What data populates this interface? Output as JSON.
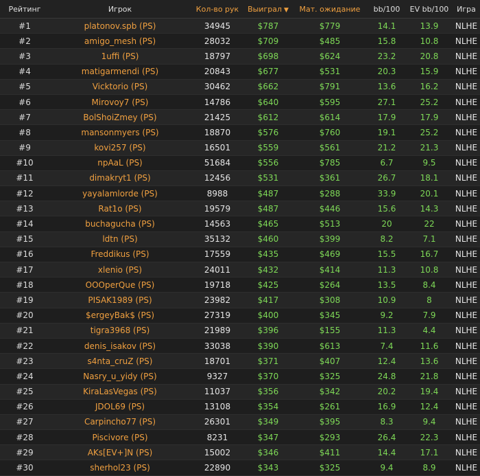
{
  "colors": {
    "accent": "#f0a040",
    "positive": "#7ed957",
    "background": "#1c1c1c"
  },
  "header": {
    "rank": "Рейтинг",
    "player": "Игрок",
    "hands": "Кол-во рук",
    "won": "Выиграл",
    "ev": "Мат. ожидание",
    "bb100": "bb/100",
    "evbb100": "EV bb/100",
    "game": "Игра",
    "sort_icon": "caret-down-icon"
  },
  "rows": [
    {
      "rank": "#1",
      "player": "platonov.spb (PS)",
      "hands": "34945",
      "won": "$787",
      "ev": "$779",
      "bb": "14.1",
      "evbb": "13.9",
      "game": "NLHE"
    },
    {
      "rank": "#2",
      "player": "amigo_mesh (PS)",
      "hands": "28032",
      "won": "$709",
      "ev": "$485",
      "bb": "15.8",
      "evbb": "10.8",
      "game": "NLHE"
    },
    {
      "rank": "#3",
      "player": "1uffi (PS)",
      "hands": "18797",
      "won": "$698",
      "ev": "$624",
      "bb": "23.2",
      "evbb": "20.8",
      "game": "NLHE"
    },
    {
      "rank": "#4",
      "player": "matigarmendi (PS)",
      "hands": "20843",
      "won": "$677",
      "ev": "$531",
      "bb": "20.3",
      "evbb": "15.9",
      "game": "NLHE"
    },
    {
      "rank": "#5",
      "player": "Vicktorio (PS)",
      "hands": "30462",
      "won": "$662",
      "ev": "$791",
      "bb": "13.6",
      "evbb": "16.2",
      "game": "NLHE"
    },
    {
      "rank": "#6",
      "player": "Mirovoy7 (PS)",
      "hands": "14786",
      "won": "$640",
      "ev": "$595",
      "bb": "27.1",
      "evbb": "25.2",
      "game": "NLHE"
    },
    {
      "rank": "#7",
      "player": "BolShoiZmey (PS)",
      "hands": "21425",
      "won": "$612",
      "ev": "$614",
      "bb": "17.9",
      "evbb": "17.9",
      "game": "NLHE"
    },
    {
      "rank": "#8",
      "player": "mansonmyers (PS)",
      "hands": "18870",
      "won": "$576",
      "ev": "$760",
      "bb": "19.1",
      "evbb": "25.2",
      "game": "NLHE"
    },
    {
      "rank": "#9",
      "player": "kovi257 (PS)",
      "hands": "16501",
      "won": "$559",
      "ev": "$561",
      "bb": "21.2",
      "evbb": "21.3",
      "game": "NLHE"
    },
    {
      "rank": "#10",
      "player": "npAaL (PS)",
      "hands": "51684",
      "won": "$556",
      "ev": "$785",
      "bb": "6.7",
      "evbb": "9.5",
      "game": "NLHE"
    },
    {
      "rank": "#11",
      "player": "dimakryt1 (PS)",
      "hands": "12456",
      "won": "$531",
      "ev": "$361",
      "bb": "26.7",
      "evbb": "18.1",
      "game": "NLHE"
    },
    {
      "rank": "#12",
      "player": "yayalamlorde (PS)",
      "hands": "8988",
      "won": "$487",
      "ev": "$288",
      "bb": "33.9",
      "evbb": "20.1",
      "game": "NLHE"
    },
    {
      "rank": "#13",
      "player": "Rat1o (PS)",
      "hands": "19579",
      "won": "$487",
      "ev": "$446",
      "bb": "15.6",
      "evbb": "14.3",
      "game": "NLHE"
    },
    {
      "rank": "#14",
      "player": "buchagucha (PS)",
      "hands": "14563",
      "won": "$465",
      "ev": "$513",
      "bb": "20",
      "evbb": "22",
      "game": "NLHE"
    },
    {
      "rank": "#15",
      "player": "ldtn (PS)",
      "hands": "35132",
      "won": "$460",
      "ev": "$399",
      "bb": "8.2",
      "evbb": "7.1",
      "game": "NLHE"
    },
    {
      "rank": "#16",
      "player": "Freddikus (PS)",
      "hands": "17559",
      "won": "$435",
      "ev": "$469",
      "bb": "15.5",
      "evbb": "16.7",
      "game": "NLHE"
    },
    {
      "rank": "#17",
      "player": "xlenio (PS)",
      "hands": "24011",
      "won": "$432",
      "ev": "$414",
      "bb": "11.3",
      "evbb": "10.8",
      "game": "NLHE"
    },
    {
      "rank": "#18",
      "player": "OOOperQue (PS)",
      "hands": "19718",
      "won": "$425",
      "ev": "$264",
      "bb": "13.5",
      "evbb": "8.4",
      "game": "NLHE"
    },
    {
      "rank": "#19",
      "player": "PISAK1989 (PS)",
      "hands": "23982",
      "won": "$417",
      "ev": "$308",
      "bb": "10.9",
      "evbb": "8",
      "game": "NLHE"
    },
    {
      "rank": "#20",
      "player": "$ergeyBak$ (PS)",
      "hands": "27319",
      "won": "$400",
      "ev": "$345",
      "bb": "9.2",
      "evbb": "7.9",
      "game": "NLHE"
    },
    {
      "rank": "#21",
      "player": "tigra3968 (PS)",
      "hands": "21989",
      "won": "$396",
      "ev": "$155",
      "bb": "11.3",
      "evbb": "4.4",
      "game": "NLHE"
    },
    {
      "rank": "#22",
      "player": "denis_isakov (PS)",
      "hands": "33038",
      "won": "$390",
      "ev": "$613",
      "bb": "7.4",
      "evbb": "11.6",
      "game": "NLHE"
    },
    {
      "rank": "#23",
      "player": "s4nta_cruZ (PS)",
      "hands": "18701",
      "won": "$371",
      "ev": "$407",
      "bb": "12.4",
      "evbb": "13.6",
      "game": "NLHE"
    },
    {
      "rank": "#24",
      "player": "Nasry_u_yidy (PS)",
      "hands": "9327",
      "won": "$370",
      "ev": "$325",
      "bb": "24.8",
      "evbb": "21.8",
      "game": "NLHE"
    },
    {
      "rank": "#25",
      "player": "KiraLasVegas (PS)",
      "hands": "11037",
      "won": "$356",
      "ev": "$342",
      "bb": "20.2",
      "evbb": "19.4",
      "game": "NLHE"
    },
    {
      "rank": "#26",
      "player": "JDOL69 (PS)",
      "hands": "13108",
      "won": "$354",
      "ev": "$261",
      "bb": "16.9",
      "evbb": "12.4",
      "game": "NLHE"
    },
    {
      "rank": "#27",
      "player": "Carpincho77 (PS)",
      "hands": "26301",
      "won": "$349",
      "ev": "$395",
      "bb": "8.3",
      "evbb": "9.4",
      "game": "NLHE"
    },
    {
      "rank": "#28",
      "player": "Piscivore (PS)",
      "hands": "8231",
      "won": "$347",
      "ev": "$293",
      "bb": "26.4",
      "evbb": "22.3",
      "game": "NLHE"
    },
    {
      "rank": "#29",
      "player": "AKs[EV+]N (PS)",
      "hands": "15002",
      "won": "$346",
      "ev": "$411",
      "bb": "14.4",
      "evbb": "17.1",
      "game": "NLHE"
    },
    {
      "rank": "#30",
      "player": "sherhol23 (PS)",
      "hands": "22890",
      "won": "$343",
      "ev": "$325",
      "bb": "9.4",
      "evbb": "8.9",
      "game": "NLHE"
    }
  ]
}
